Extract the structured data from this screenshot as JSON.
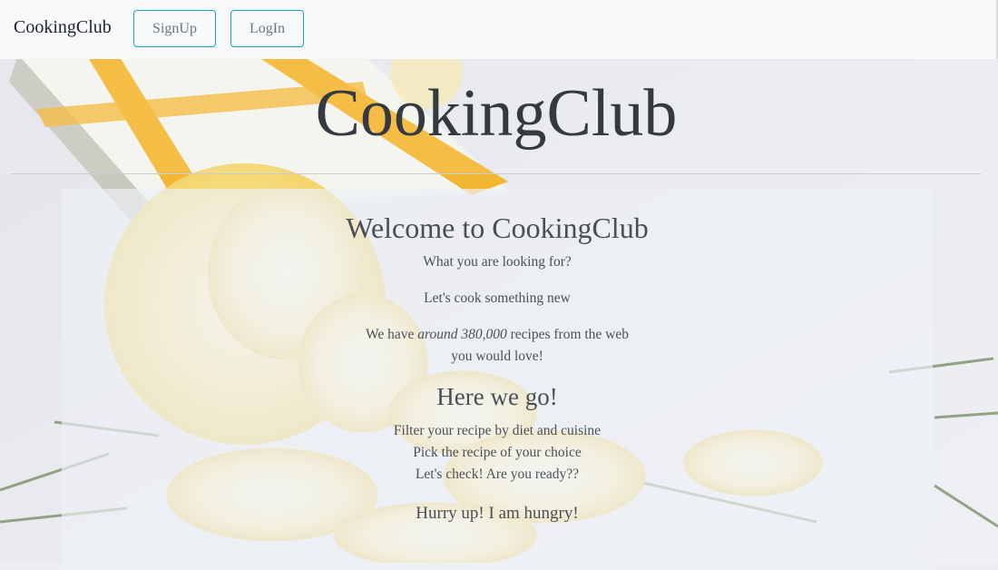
{
  "navbar": {
    "brand": "CookingClub",
    "signup_label": "SignUp",
    "login_label": "LogIn"
  },
  "hero": {
    "title": "CookingClub"
  },
  "card": {
    "welcome": "Welcome to CookingClub",
    "line1": "What you are looking for?",
    "line2": "Let's cook something new",
    "line3_prefix": "We have ",
    "line3_emphasis": "around 380,000",
    "line3_suffix": " recipes from the web",
    "line4": "you would love!",
    "heading2": "Here we go!",
    "step1": "Filter your recipe by diet and cuisine",
    "step2": "Pick the recipe of your choice",
    "step3": "Let's check! Are you ready??",
    "hurry": "Hurry up! I am hungry!"
  },
  "colors": {
    "navbar_bg": "#f8f9fa",
    "button_border": "#17a2b8",
    "button_text": "#6c757d",
    "title_text": "#343a40"
  }
}
